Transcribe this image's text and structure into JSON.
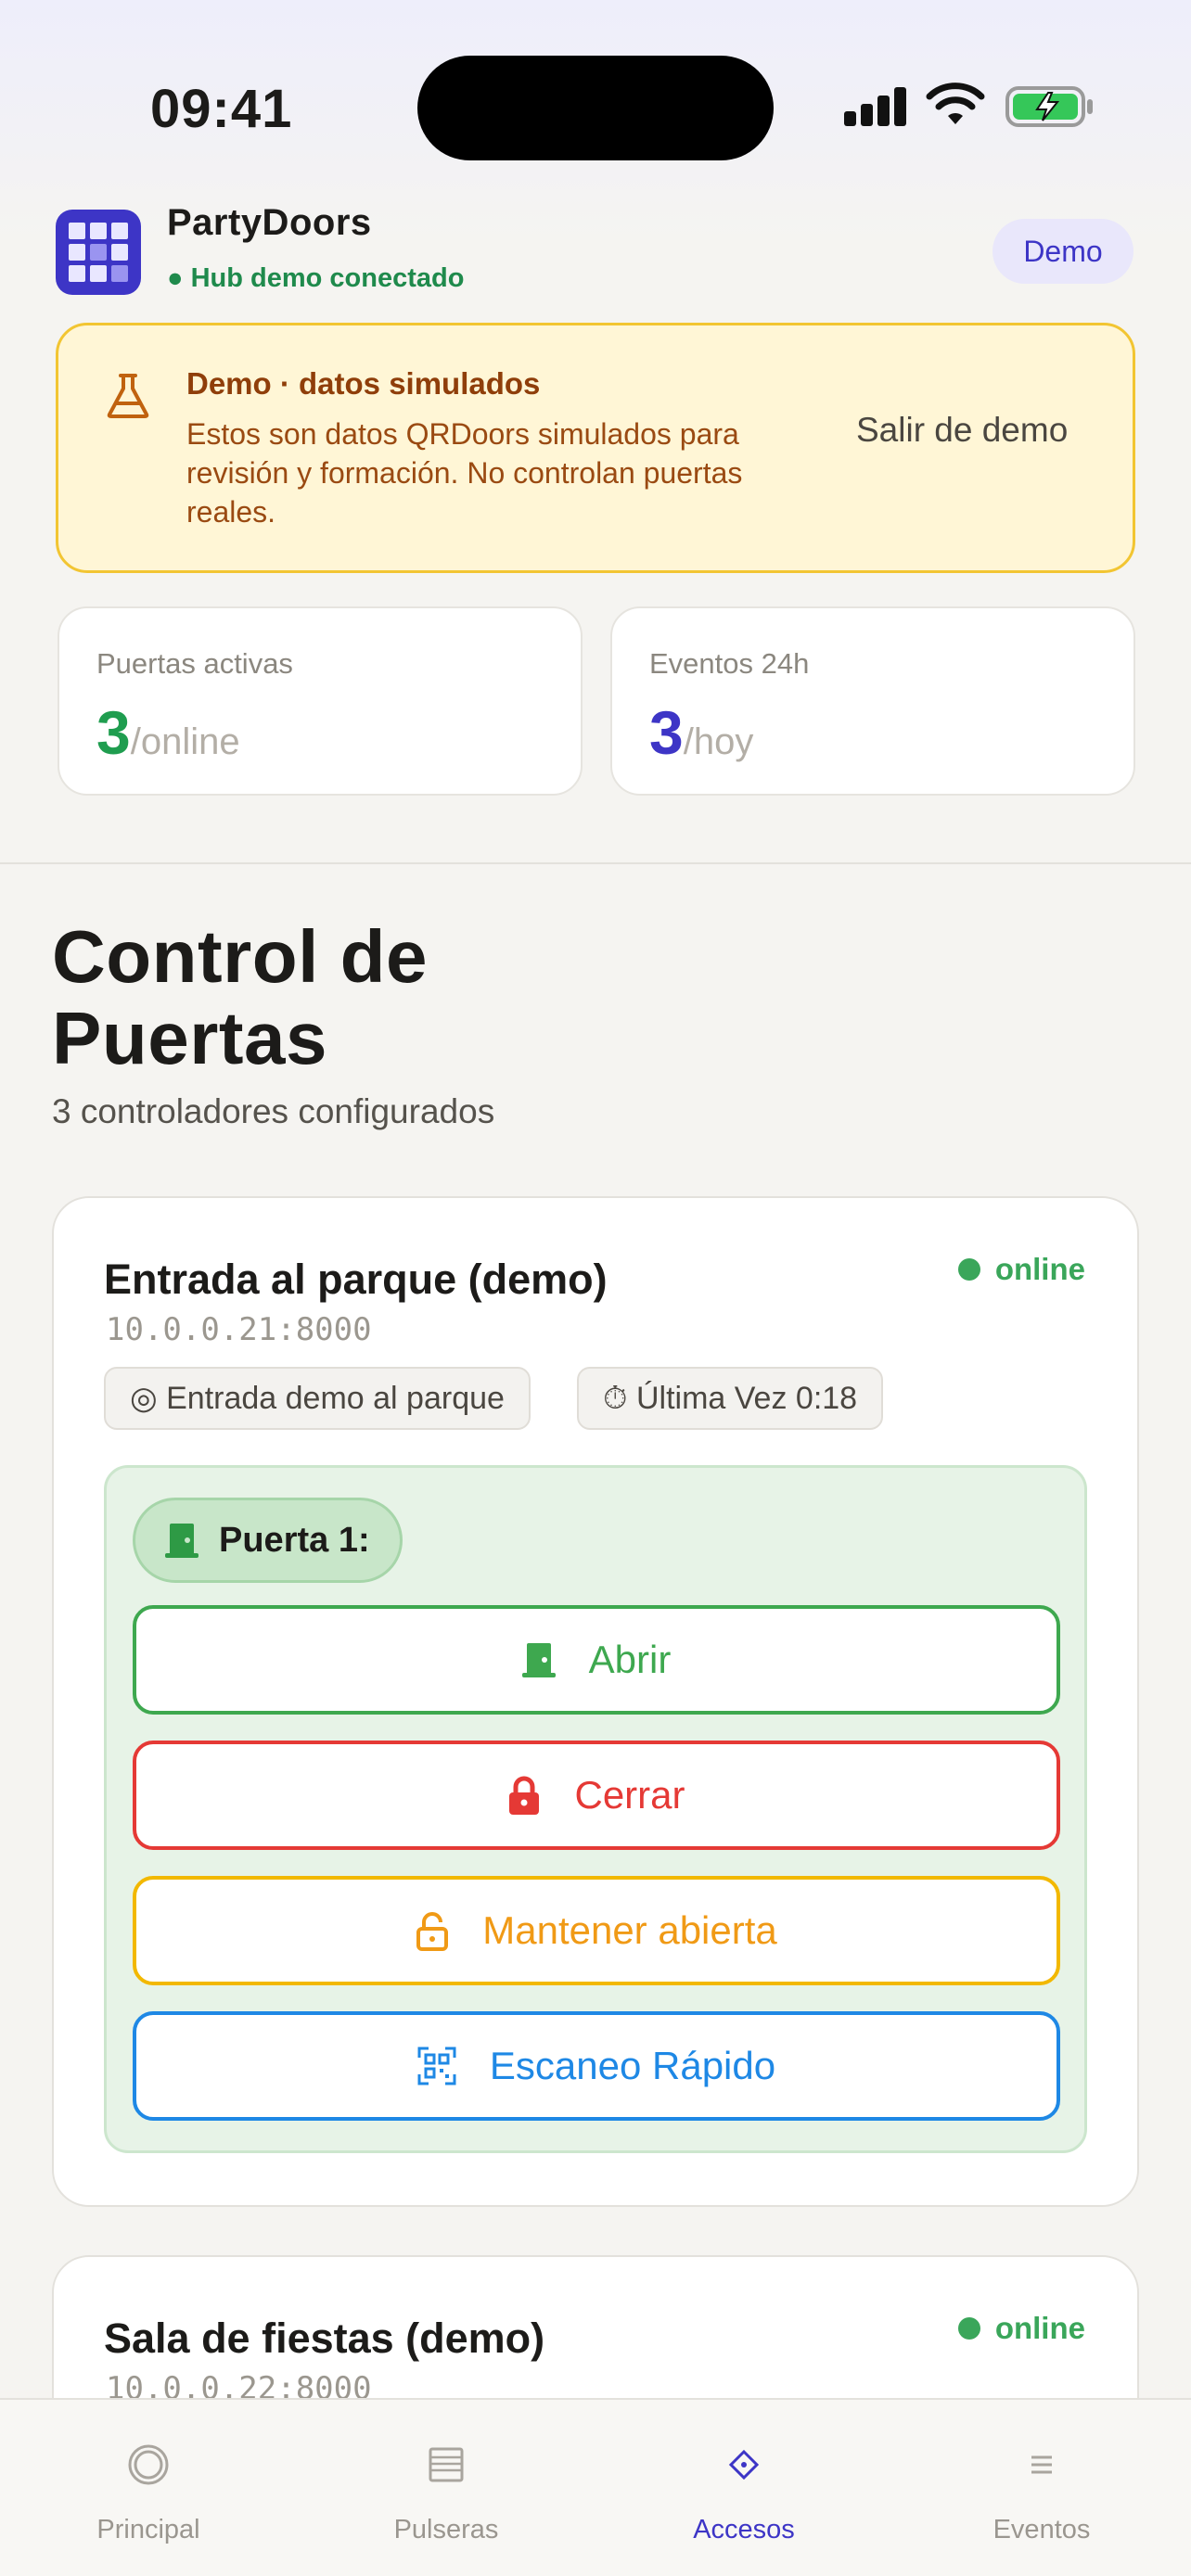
{
  "status_bar": {
    "time": "09:41"
  },
  "header": {
    "app_name": "PartyDoors",
    "connection": "● Hub demo conectado",
    "mode_badge": "Demo"
  },
  "banner": {
    "title": "Demo · datos simulados",
    "text": "Estos son datos QRDoors simulados para revisión y formación. No controlan puertas reales.",
    "action": "Salir de demo"
  },
  "stats": [
    {
      "label": "Puertas activas",
      "value": "3",
      "suffix": "/online",
      "color": "#1f9d4f"
    },
    {
      "label": "Eventos 24h",
      "value": "3",
      "suffix": "/hoy",
      "color": "#3d35c6"
    }
  ],
  "page": {
    "title_line1": "Control de",
    "title_line2": "Puertas",
    "subtitle": "3 controladores configurados"
  },
  "controllers": [
    {
      "name": "Entrada al parque (demo)",
      "address": "10.0.0.21:8000",
      "status": "online",
      "location_chip": "◎ Entrada demo al parque",
      "last_seen_chip": "⏱ Última Vez 0:18",
      "door": {
        "label": "Puerta 1:",
        "actions": [
          {
            "label": "Abrir",
            "color": "#3ea84f"
          },
          {
            "label": "Cerrar",
            "color": "#e53935"
          },
          {
            "label": "Mantener abierta",
            "color": "#f09a16"
          },
          {
            "label": "Escaneo Rápido",
            "color": "#1e88e5"
          }
        ]
      }
    },
    {
      "name": "Sala de fiestas (demo)",
      "address": "10.0.0.22:8000",
      "status": "online"
    }
  ],
  "tabs": [
    {
      "label": "Principal",
      "icon": "circle-icon",
      "active": false
    },
    {
      "label": "Pulseras",
      "icon": "list-card-icon",
      "active": false
    },
    {
      "label": "Accesos",
      "icon": "diamond-icon",
      "active": true
    },
    {
      "label": "Eventos",
      "icon": "lines-icon",
      "active": false
    }
  ],
  "colors": {
    "accent": "#3d35c6",
    "online": "#3aa65a",
    "warning_bg": "#fff6d6",
    "warning_border": "#f2c532"
  }
}
